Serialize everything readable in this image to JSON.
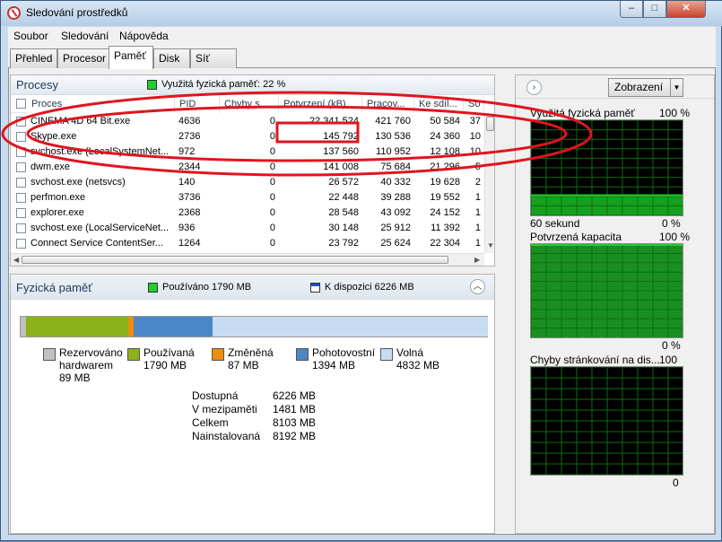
{
  "window": {
    "title": "Sledování prostředků"
  },
  "menu": [
    "Soubor",
    "Sledování",
    "Nápověda"
  ],
  "tabs": [
    "Přehled",
    "Procesor",
    "Paměť",
    "Disk",
    "Síť"
  ],
  "processes": {
    "title": "Procesy",
    "usage_label": "Využitá fyzická paměť: 22 %",
    "columns": [
      "Proces",
      "PID",
      "Chyby s...",
      "Potvrzení (kB)",
      "Pracov...",
      "Ke sdíl...",
      "So"
    ],
    "rows": [
      {
        "name": "CINEMA 4D 64 Bit.exe",
        "pid": "4636",
        "faults": "0",
        "commit": "22 341 524",
        "working": "421 760",
        "shareable": "50 584",
        "sold": "37"
      },
      {
        "name": "Skype.exe",
        "pid": "2736",
        "faults": "0",
        "commit": "145 792",
        "working": "130 536",
        "shareable": "24 360",
        "sold": "10"
      },
      {
        "name": "svchost.exe (LocalSystemNet...",
        "pid": "972",
        "faults": "0",
        "commit": "137 560",
        "working": "110 952",
        "shareable": "12 108",
        "sold": "10"
      },
      {
        "name": "dwm.exe",
        "pid": "2344",
        "faults": "0",
        "commit": "141 008",
        "working": "75 684",
        "shareable": "21 296",
        "sold": "5"
      },
      {
        "name": "svchost.exe (netsvcs)",
        "pid": "140",
        "faults": "0",
        "commit": "26 572",
        "working": "40 332",
        "shareable": "19 628",
        "sold": "2"
      },
      {
        "name": "perfmon.exe",
        "pid": "3736",
        "faults": "0",
        "commit": "22 448",
        "working": "39 288",
        "shareable": "19 552",
        "sold": "1"
      },
      {
        "name": "explorer.exe",
        "pid": "2368",
        "faults": "0",
        "commit": "28 548",
        "working": "43 092",
        "shareable": "24 152",
        "sold": "1"
      },
      {
        "name": "svchost.exe (LocalServiceNet...",
        "pid": "936",
        "faults": "0",
        "commit": "30 148",
        "working": "25 912",
        "shareable": "11 392",
        "sold": "1"
      },
      {
        "name": "Connect Service ContentSer...",
        "pid": "1264",
        "faults": "0",
        "commit": "23 792",
        "working": "25 624",
        "shareable": "22 304",
        "sold": "1"
      }
    ]
  },
  "physical": {
    "title": "Fyzická paměť",
    "used_label": "Používáno 1790 MB",
    "available_label": "K dispozici 6226 MB",
    "bar": {
      "hardware_mb": 89,
      "used_mb": 1790,
      "modified_mb": 87,
      "standby_mb": 1394,
      "free_mb": 4832,
      "total_mb": 8192
    },
    "legend": [
      {
        "line1": "Rezervováno",
        "line2": "hardwarem",
        "line3": "89 MB",
        "color": "#c0c0c0"
      },
      {
        "line1": "Používaná",
        "line2": "1790 MB",
        "color": "#8bb21a"
      },
      {
        "line1": "Změněná",
        "line2": "87 MB",
        "color": "#ef8c0f"
      },
      {
        "line1": "Pohotovostní",
        "line2": "1394 MB",
        "color": "#4a86c8"
      },
      {
        "line1": "Volná",
        "line2": "4832 MB",
        "color": "#c7dcf3"
      }
    ],
    "stats": [
      {
        "label": "Dostupná",
        "value": "6226 MB"
      },
      {
        "label": "V mezipaměti",
        "value": "1481 MB"
      },
      {
        "label": "Celkem",
        "value": "8103 MB"
      },
      {
        "label": "Nainstalovaná",
        "value": "8192 MB"
      }
    ]
  },
  "right": {
    "view_label": "Zobrazení",
    "graphs": [
      {
        "title": "Využitá fyzická paměť",
        "max": "100 %",
        "footer_left": "60 sekund",
        "footer_right": "0 %",
        "level": 0.22
      },
      {
        "title": "Potvrzená kapacita",
        "max": "100 %",
        "footer_left": "",
        "footer_right": "0 %",
        "level": 1.0
      },
      {
        "title": "Chyby stránkování na dis...",
        "max": "100",
        "footer_left": "",
        "footer_right": "0",
        "level": 0.0
      }
    ]
  },
  "colors": {
    "graph_green": "#1fcf2a",
    "grid_green": "#0a6e12",
    "annotation_red": "#e0141e"
  }
}
